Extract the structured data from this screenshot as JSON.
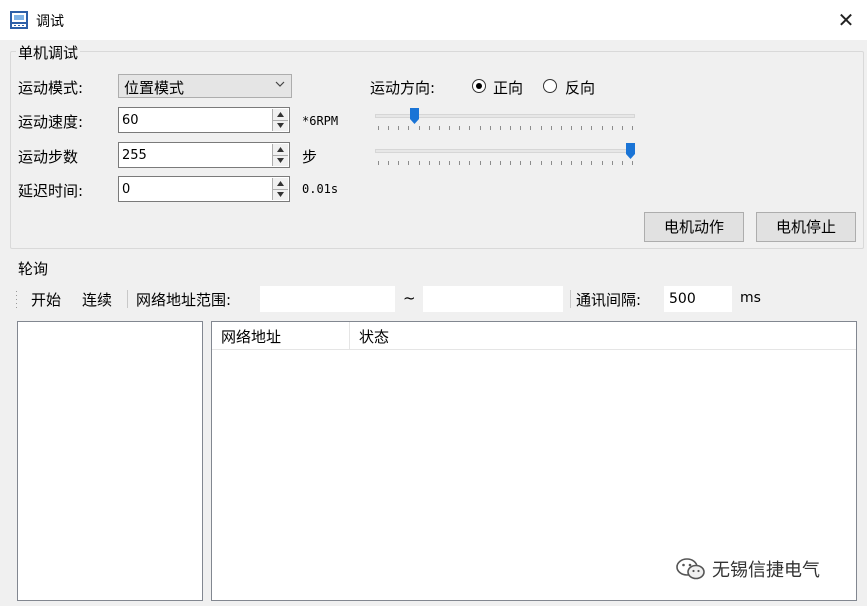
{
  "window": {
    "title": "调试",
    "close_glyph": "✕",
    "icon": "app-monitor-icon"
  },
  "single": {
    "group_title": "单机调试",
    "mode_label": "运动模式:",
    "mode_value": "位置模式",
    "speed_label": "运动速度:",
    "speed_value": "60",
    "speed_unit": "*6RPM",
    "steps_label": "运动步数",
    "steps_value": "255",
    "steps_unit": "步",
    "delay_label": "延迟时间:",
    "delay_value": "0",
    "delay_unit": "0.01s",
    "direction_label": "运动方向:",
    "dir_forward": "正向",
    "dir_reverse": "反向",
    "direction_selected": "正向",
    "speed_slider_level": 0.14,
    "steps_slider_level": 1.0,
    "motor_run_btn": "电机动作",
    "motor_stop_btn": "电机停止"
  },
  "poll": {
    "group_title": "轮询",
    "start_btn": "开始",
    "continuous_btn": "连续",
    "range_label": "网络地址范围:",
    "range_from": "",
    "range_sep": "~",
    "range_to": "",
    "interval_label": "通讯间隔:",
    "interval_value": "500",
    "interval_unit": "ms",
    "table_columns": [
      "网络地址",
      "状态"
    ]
  },
  "watermark": {
    "text": "无锡信捷电气",
    "icon": "wechat-icon"
  }
}
